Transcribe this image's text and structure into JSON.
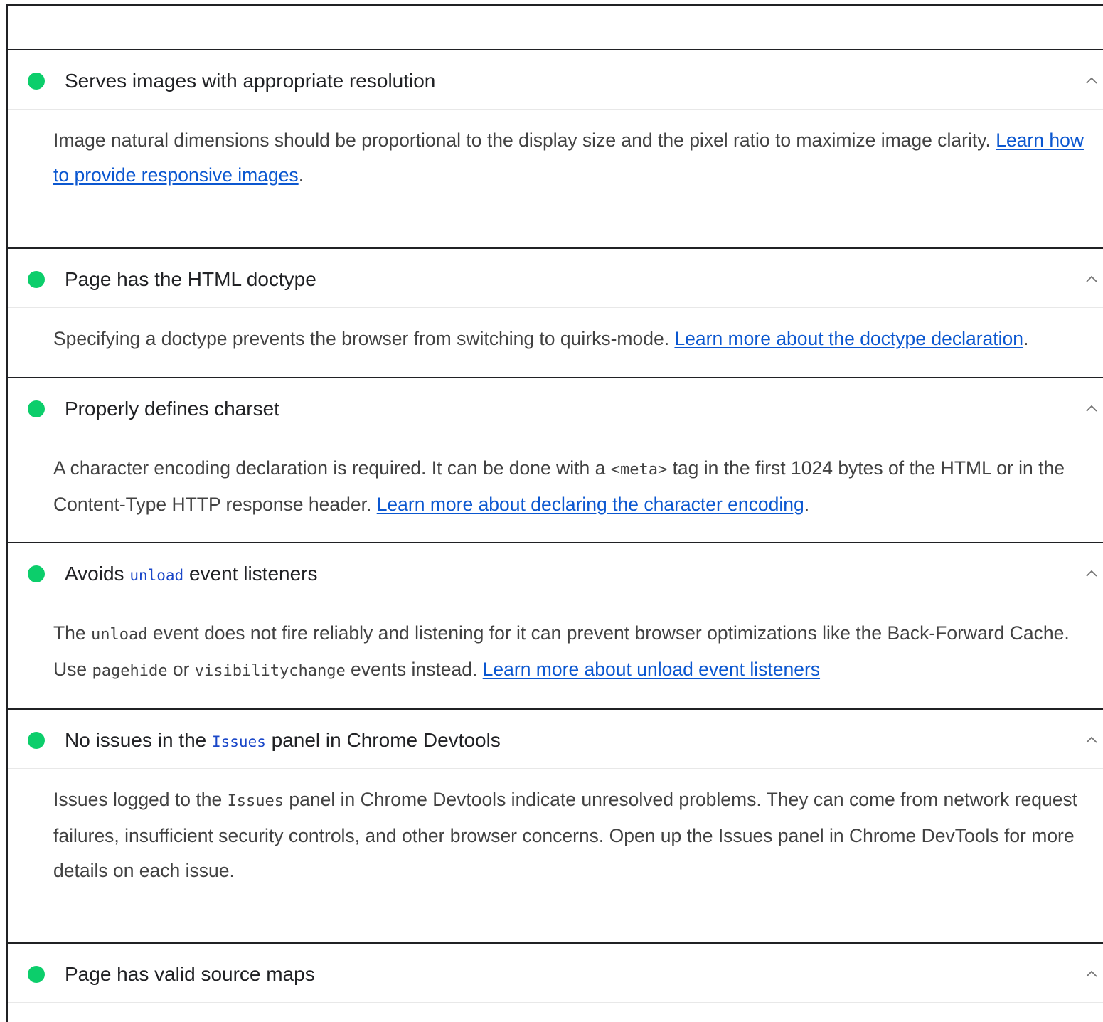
{
  "audits": [
    {
      "title_parts": [
        "Serves images with appropriate resolution"
      ],
      "description": "Image natural dimensions should be proportional to the display size and the pixel ratio to maximize image clarity. ",
      "link": "Learn how to provide responsive images",
      "after_link": "."
    },
    {
      "title_parts": [
        "Page has the HTML doctype"
      ],
      "description": "Specifying a doctype prevents the browser from switching to quirks-mode. ",
      "link": "Learn more about the doctype declaration",
      "after_link": "."
    },
    {
      "title_parts": [
        "Properly defines charset"
      ],
      "description_parts": [
        "A character encoding declaration is required. It can be done with a ",
        "<meta>",
        " tag in the first 1024 bytes of the HTML or in the Content-Type HTTP response header. "
      ],
      "link": "Learn more about declaring the character encoding",
      "after_link": "."
    },
    {
      "title_parts": [
        "Avoids ",
        "unload",
        " event listeners"
      ],
      "description_parts": [
        "The ",
        "unload",
        " event does not fire reliably and listening for it can prevent browser optimizations like the Back-Forward Cache. Use ",
        "pagehide",
        " or ",
        "visibilitychange",
        " events instead. "
      ],
      "link": "Learn more about unload event listeners",
      "after_link": ""
    },
    {
      "title_parts": [
        "No issues in the ",
        "Issues",
        " panel in Chrome Devtools"
      ],
      "description_parts": [
        "Issues logged to the ",
        "Issues",
        " panel in Chrome Devtools indicate unresolved problems. They can come from network request failures, insufficient security controls, and other browser concerns. Open up the Issues panel in Chrome DevTools for more details on each issue."
      ]
    },
    {
      "title_parts": [
        "Page has valid source maps"
      ]
    }
  ],
  "colors": {
    "pass": "#0cce6b",
    "link": "#0b57d0",
    "code_title": "#1a47c8"
  }
}
